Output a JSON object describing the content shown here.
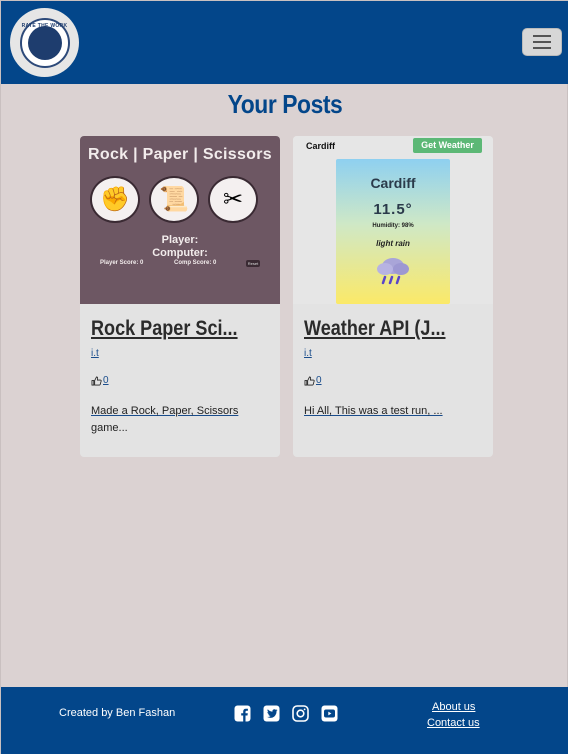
{
  "navbar": {
    "logo_text": "RATE THE WORK",
    "toggler_icon": "hamburger-menu-icon"
  },
  "page": {
    "title": "Your Posts"
  },
  "posts": [
    {
      "title": "Rock Paper Sci...",
      "author": "i.t",
      "likes": "0",
      "excerpt_line1": "Made a Rock, Paper, Scissors",
      "excerpt_line2": "game...",
      "image": {
        "heading": "Rock | Paper | Scissors",
        "player_label": "Player:",
        "computer_label": "Computer:",
        "player_score": "Player Score: 0",
        "comp_score": "Comp Score: 0",
        "reset_label": "Reset"
      }
    },
    {
      "title": "Weather API (J...",
      "author": "i.t",
      "likes": "0",
      "excerpt_line1": "Hi All, This was a test run, ...",
      "excerpt_line2": "",
      "image": {
        "city_top": "Cardiff",
        "button_label": "Get Weather",
        "city": "Cardiff",
        "temp": "11.5°",
        "humidity": "Humidity: 98%",
        "description": "light rain"
      }
    }
  ],
  "footer": {
    "credit": "Created by Ben Fashan",
    "social_icons": [
      "facebook-icon",
      "twitter-icon",
      "instagram-icon",
      "youtube-icon"
    ],
    "about_link": "About us",
    "contact_link": "Contact us"
  },
  "colors": {
    "brand_blue": "#03468a",
    "page_bg": "#dbd2d2",
    "card_bg": "#e3e3e3"
  }
}
